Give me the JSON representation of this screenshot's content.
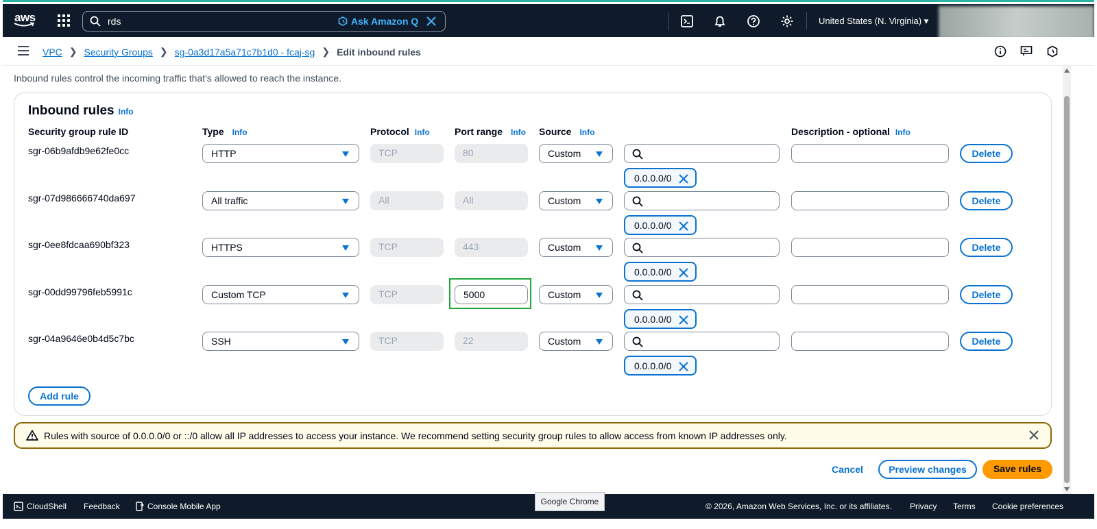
{
  "topnav": {
    "logo_text": "aws",
    "search_value": "rds",
    "ask_q_label": "Ask Amazon Q",
    "region": "United States (N. Virginia) ▾"
  },
  "breadcrumbs": {
    "items": [
      "VPC",
      "Security Groups",
      "sg-0a3d17a5a71c7b1d0 - fcaj-sg"
    ],
    "current": "Edit inbound rules"
  },
  "description": "Inbound rules control the incoming traffic that's allowed to reach the instance.",
  "panel": {
    "title": "Inbound rules",
    "info": "Info",
    "columns": {
      "rule_id": "Security group rule ID",
      "type": "Type",
      "protocol": "Protocol",
      "port_range": "Port range",
      "source": "Source",
      "description": "Description - optional"
    },
    "rows": [
      {
        "id": "sgr-06b9afdb9e62fe0cc",
        "type": "HTTP",
        "protocol": "TCP",
        "port": "80",
        "source": "Custom",
        "cidr": "0.0.0.0/0",
        "delete": "Delete"
      },
      {
        "id": "sgr-07d986666740da697",
        "type": "All traffic",
        "protocol": "All",
        "port": "All",
        "source": "Custom",
        "cidr": "0.0.0.0/0",
        "delete": "Delete"
      },
      {
        "id": "sgr-0ee8fdcaa690bf323",
        "type": "HTTPS",
        "protocol": "TCP",
        "port": "443",
        "source": "Custom",
        "cidr": "0.0.0.0/0",
        "delete": "Delete"
      },
      {
        "id": "sgr-00dd99796feb5991c",
        "type": "Custom TCP",
        "protocol": "TCP",
        "port": "5000",
        "source": "Custom",
        "cidr": "0.0.0.0/0",
        "delete": "Delete"
      },
      {
        "id": "sgr-04a9646e0b4d5c7bc",
        "type": "SSH",
        "protocol": "TCP",
        "port": "22",
        "source": "Custom",
        "cidr": "0.0.0.0/0",
        "delete": "Delete"
      }
    ],
    "add_rule": "Add rule"
  },
  "warning": "Rules with source of 0.0.0.0/0 or ::/0 allow all IP addresses to access your instance. We recommend setting security group rules to allow access from known IP addresses only.",
  "actions": {
    "cancel": "Cancel",
    "preview": "Preview changes",
    "save": "Save rules"
  },
  "footer": {
    "cloudshell": "CloudShell",
    "feedback": "Feedback",
    "mobile": "Console Mobile App",
    "copyright": "© 2026, Amazon Web Services, Inc. or its affiliates.",
    "privacy": "Privacy",
    "terms": "Terms",
    "cookies": "Cookie preferences"
  },
  "tooltip": "Google Chrome",
  "colors": {
    "nav_bg": "#0f1b2a",
    "link": "#0972d3",
    "primary": "#ff9900",
    "warning_border": "#8d6605",
    "highlight": "#1fa73a"
  }
}
